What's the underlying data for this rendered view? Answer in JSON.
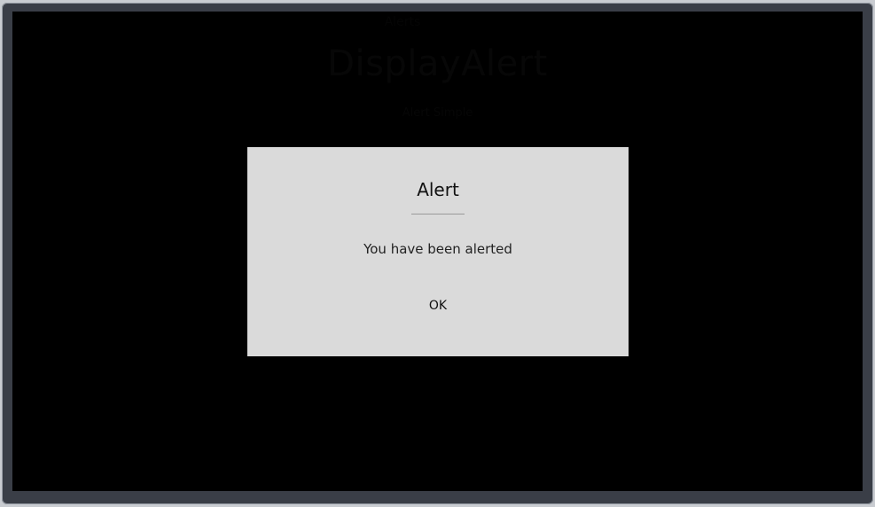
{
  "app": {
    "title": "Alerts",
    "heading": "DisplayAlert",
    "subtext": "Alert Simple"
  },
  "dialog": {
    "title": "Alert",
    "message": "You have been alerted",
    "ok_label": "OK"
  },
  "colors": {
    "screen_background": "#000000",
    "dialog_background": "#dadada",
    "frame": "#3a3e47"
  }
}
